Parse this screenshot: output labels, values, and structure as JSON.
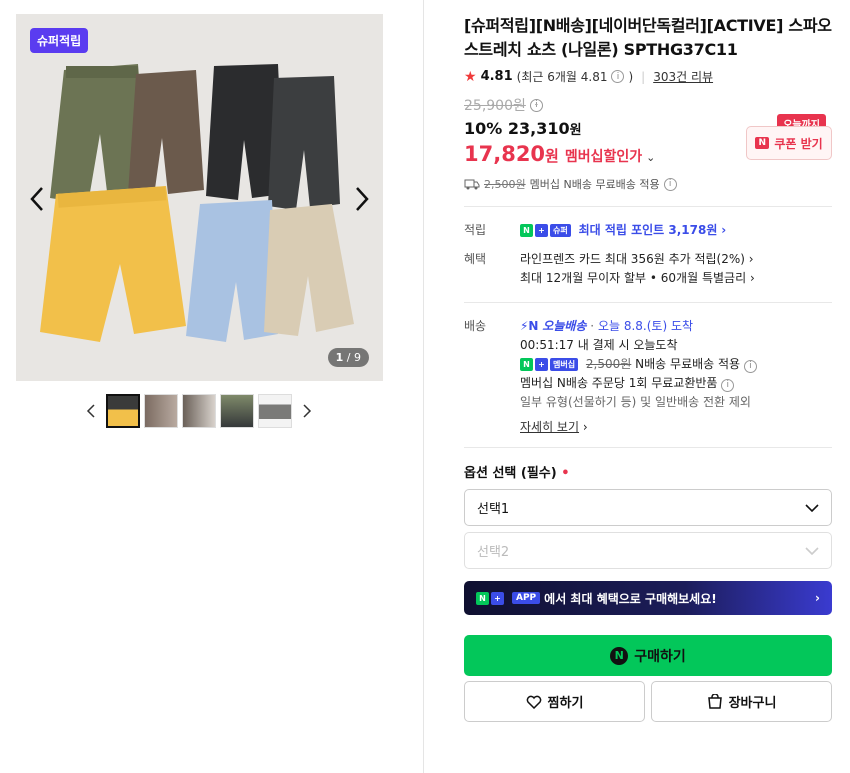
{
  "gallery": {
    "badge": "슈퍼적립",
    "counter_current": "1",
    "counter_total": "/ 9"
  },
  "product": {
    "title": "[슈퍼적립][N배송][네이버단독컬러][ACTIVE] 스파오 스트레치 쇼츠 (나일론) SPTHG37C11",
    "rating": "4.81",
    "rating_recent": "(최근 6개월 4.81",
    "rating_recent_close": ")",
    "review_count": "303건 리뷰",
    "original_price": "25,900원",
    "discount_rate": "10%",
    "sale_price": "23,310",
    "sale_unit": "원",
    "member_price": "17,820",
    "member_unit": "원",
    "member_label": "멤버십할인가",
    "coupon_tag": "오늘까지",
    "coupon_label": "쿠폰 받기",
    "shipping_fee": "2,500원",
    "shipping_text": "멤버십 N배송 무료배송 적용"
  },
  "benefits": {
    "point_key": "적립",
    "point_badge_text": "슈퍼",
    "point_text": "최대 적립 포인트 3,178원",
    "benefit_key": "혜택",
    "benefit_line1": "라인프렌즈 카드 최대 356원 추가 적립(2%)",
    "benefit_line2": "최대 12개월 무이자 할부 • 60개월 특별금리"
  },
  "delivery": {
    "key": "배송",
    "today_label": "오늘배송",
    "arrival": "오늘 8.8.(토) 도착",
    "countdown": "00:51:17",
    "countdown_text": "내 결제 시 오늘도착",
    "member_badge": "멤버십",
    "fee": "2,500원",
    "fee_text": "N배송 무료배송 적용",
    "exchange": "멤버십 N배송 주문당 1회 무료교환반품",
    "exclusion": "일부 유형(선물하기 등) 및 일반배송 전환 제외",
    "detail_link": "자세히 보기"
  },
  "options": {
    "label": "옵션 선택 (필수)",
    "required_mark": "•",
    "select1": "선택1",
    "select2": "선택2"
  },
  "app_banner": {
    "badge": "APP",
    "text": "에서 최대 혜택으로 구매해보세요!"
  },
  "actions": {
    "buy": "구매하기",
    "wishlist": "찜하기",
    "cart": "장바구니"
  }
}
